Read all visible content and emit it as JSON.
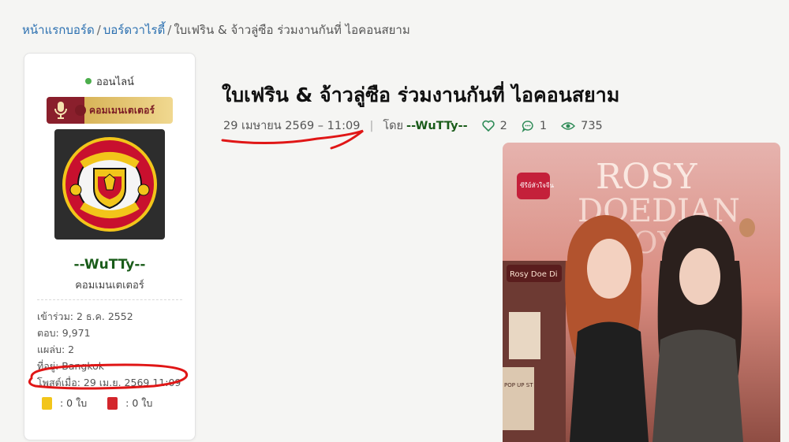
{
  "breadcrumb": {
    "home": "หน้าแรกบอร์ด",
    "forum": "บอร์ดวาไรตี้",
    "current": "ใบเฟริน & จ้าวลู่ซือ ร่วมงานกันที่ ไอคอนสยาม",
    "separator": "/"
  },
  "user": {
    "online_label": "ออนไลน์",
    "rank_badge": "คอมเมนเตเตอร์",
    "avatar_icon": "manchester-united-crest",
    "username": "--WuTTy--",
    "title": "คอมเมนเตเตอร์",
    "stats": {
      "joined": "เข้าร่วม: 2 ธ.ค. 2552",
      "replies": "ตอบ: 9,971",
      "likes": "แผล่บ: 2",
      "location": "ที่อยู่: Bangkok",
      "posted": "โพสต์เมื่อ: 29 เม.ย. 2569 11:09"
    },
    "yellow_cards": ": 0 ใบ",
    "red_cards": ": 0 ใบ"
  },
  "post": {
    "title": "ใบเฟริน & จ้าวลู่ซือ ร่วมงานกันที่ ไอคอนสยาม",
    "date": "29 เมษายน 2569 – 11:09",
    "by_label": "โดย",
    "author": "--WuTTy--",
    "likes": "2",
    "comments": "1",
    "views": "735",
    "image": {
      "headline_1": "ROSY",
      "headline_2": "DOEDIAN",
      "headline_3": "JOY",
      "badge": "ซีรีย์หัวใจจีน",
      "sign_1": "Rosy Doe Di",
      "sign_2": "POP UP ST"
    }
  },
  "colors": {
    "link": "#2a6fb0",
    "username": "#1a5c1a",
    "online": "#4cae4c",
    "annotation": "#e01616"
  }
}
